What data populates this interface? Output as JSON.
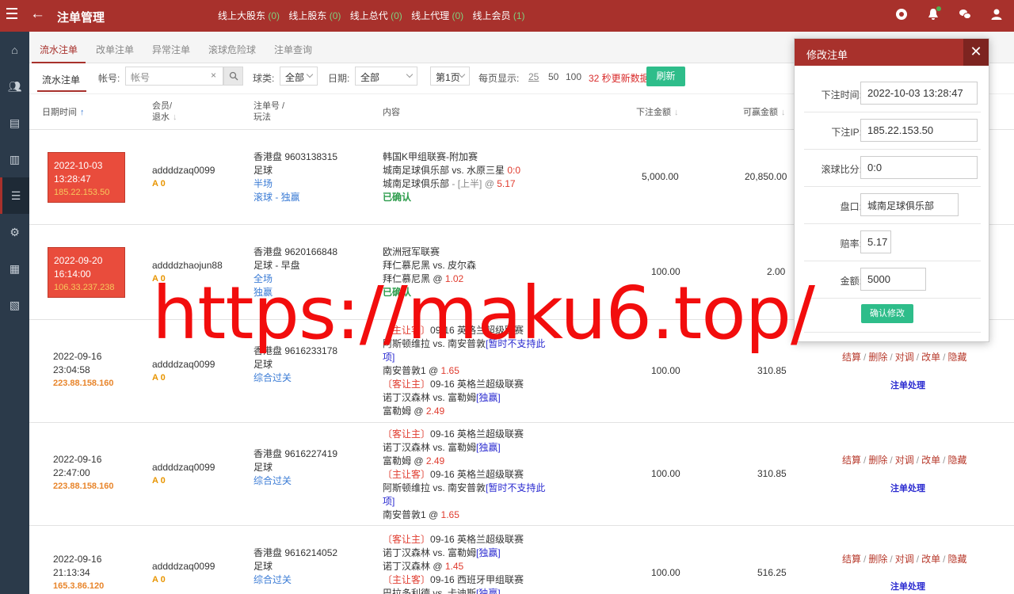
{
  "header": {
    "title": "注单管理",
    "stats": [
      {
        "label": "线上大股东",
        "count": "(0)"
      },
      {
        "label": "线上股东",
        "count": "(0)"
      },
      {
        "label": "线上总代",
        "count": "(0)"
      },
      {
        "label": "线上代理",
        "count": "(0)"
      },
      {
        "label": "线上会员",
        "count": "(1)"
      }
    ]
  },
  "tabs": [
    "流水注单",
    "改单注单",
    "异常注单",
    "滚球危险球",
    "注单查询"
  ],
  "filters": {
    "sub_tab": "流水注单",
    "account_label": "帐号:",
    "account_placeholder": "帐号",
    "sport_label": "球类:",
    "sport_value": "全部",
    "date_label": "日期:",
    "date_value": "全部",
    "page_value": "第1页",
    "per_page_label": "每页显示:",
    "per_page_options": [
      "25",
      "50",
      "100"
    ],
    "refresh_note": "32 秒更新数据",
    "refresh_button": "刷新"
  },
  "table": {
    "headers": {
      "date": "日期时间",
      "member_1": "会员/",
      "member_2": "退水",
      "order_1": "注单号 /",
      "order_2": "玩法",
      "content": "内容",
      "amount": "下注金额",
      "win": "可赢金额"
    },
    "rows": [
      {
        "date": "2022-10-03",
        "time": "13:28:47",
        "ip": "185.22.153.50",
        "member": "addddzaq0099",
        "agent": "A 0",
        "order": [
          "香港盘 9603138315",
          "足球",
          "半场",
          "滚球 - 独赢"
        ],
        "content": [
          "韩国K甲组联赛-附加赛",
          "城南足球俱乐部  vs.  水原三星",
          "0:0",
          "城南足球俱乐部",
          "- [上半] @",
          "5.17",
          "已确认"
        ],
        "amount": "5,000.00",
        "win": "20,850.00"
      },
      {
        "date": "2022-09-20",
        "time": "16:14:00",
        "ip": "106.33.237.238",
        "member": "addddzhaojun88",
        "agent": "A 0",
        "order": [
          "香港盘 9620166848",
          "足球 - 早盘",
          "全场",
          "独赢"
        ],
        "content": [
          "欧洲冠军联赛",
          "拜仁慕尼黑  vs.  皮尔森",
          "拜仁慕尼黑 @",
          "1.02",
          "已确认"
        ],
        "amount": "100.00",
        "win": "2.00"
      },
      {
        "date": "2022-09-16",
        "time": "23:04:58",
        "ip": "223.88.158.160",
        "member": "addddzaq0099",
        "agent": "A 0",
        "order": [
          "香港盘 9616233178",
          "足球",
          "综合过关"
        ],
        "content": [
          "〔主让客〕",
          "09-16 英格兰超级联赛",
          "阿斯顿维拉 vs. 南安普敦",
          "[暂时不支持此",
          "项]",
          "南安普敦1 @",
          "1.65",
          "〔客让主〕",
          "09-16 英格兰超级联赛",
          "诺丁汉森林 vs. 富勒姆",
          "[独赢]",
          "富勒姆 @",
          "2.49"
        ],
        "amount": "100.00",
        "win": "310.85",
        "actions": [
          "结算",
          "删除",
          "对调",
          "改单",
          "隐藏"
        ],
        "sub_action": "注单处理"
      },
      {
        "date": "2022-09-16",
        "time": "22:47:00",
        "ip": "223.88.158.160",
        "member": "addddzaq0099",
        "agent": "A 0",
        "order": [
          "香港盘 9616227419",
          "足球",
          "综合过关"
        ],
        "content": [
          "〔客让主〕",
          "09-16 英格兰超级联赛",
          "诺丁汉森林 vs. 富勒姆",
          "[独赢]",
          "富勒姆 @",
          "2.49",
          "〔主让客〕",
          "09-16 英格兰超级联赛",
          "阿斯顿维拉 vs. 南安普敦",
          "[暂时不支持此",
          "项]",
          "南安普敦1 @",
          "1.65"
        ],
        "amount": "100.00",
        "win": "310.85",
        "actions": [
          "结算",
          "删除",
          "对调",
          "改单",
          "隐藏"
        ],
        "sub_action": "注单处理"
      },
      {
        "date": "2022-09-16",
        "time": "21:13:34",
        "ip": "165.3.86.120",
        "member": "addddzaq0099",
        "agent": "A 0",
        "order": [
          "香港盘 9616214052",
          "足球",
          "综合过关"
        ],
        "content": [
          "〔客让主〕",
          "09-16 英格兰超级联赛",
          "诺丁汉森林 vs. 富勒姆",
          "[独赢]",
          "诺丁汉森林 @",
          "1.45",
          "〔主让客〕",
          "09-16 西班牙甲组联赛",
          "巴拉多利德 vs. 卡迪斯",
          "[独赢]"
        ],
        "amount": "100.00",
        "win": "516.25",
        "actions": [
          "结算",
          "删除",
          "对调",
          "改单",
          "隐藏"
        ],
        "sub_action": "注单处理"
      }
    ]
  },
  "modal": {
    "title": "修改注单",
    "fields": [
      {
        "label": "下注时间:",
        "value": "2022-10-03 13:28:47"
      },
      {
        "label": "下注IP:",
        "value": "185.22.153.50"
      },
      {
        "label": "滚球比分:",
        "value": "0:0"
      },
      {
        "label": "盘口:",
        "value": "城南足球俱乐部"
      },
      {
        "label": "赔率:",
        "value": "5.17"
      },
      {
        "label": "金额:",
        "value": "5000"
      }
    ],
    "confirm": "确认修改"
  },
  "watermark": "https://maku6.top/",
  "colors": {
    "brand": "#a8312c",
    "green": "#2ebd8a",
    "sidebar": "#2b3a4a"
  }
}
